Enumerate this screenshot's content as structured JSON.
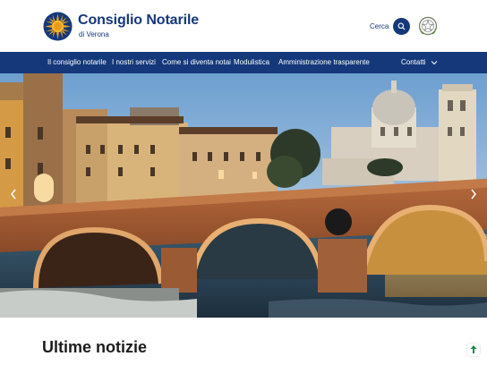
{
  "header": {
    "title": "Consiglio Notarile",
    "subtitle": "di Verona",
    "search_label": "Cerca"
  },
  "nav": {
    "items": [
      {
        "label": "Il consiglio notarile"
      },
      {
        "label": "I nostri servizi"
      },
      {
        "label": "Come si diventa notai"
      },
      {
        "label": "Modulistica"
      },
      {
        "label": "Amministrazione trasparente"
      }
    ],
    "contacts_label": "Contatti"
  },
  "news": {
    "title": "Ultime notizie"
  },
  "colors": {
    "brand": "#14387a",
    "nav_bg": "#14387a",
    "accent_green": "#1b8a4f"
  },
  "icons": [
    "logo-sun-icon",
    "search-icon",
    "emblem-icon",
    "chevron-down-icon",
    "chevron-left-icon",
    "chevron-right-icon",
    "arrow-up-icon"
  ]
}
